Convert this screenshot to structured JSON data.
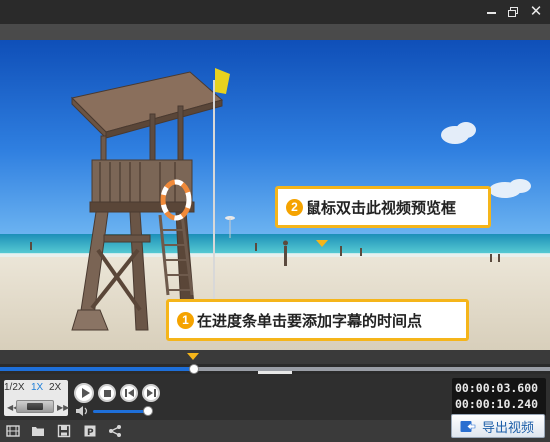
{
  "window": {
    "minimize_icon": "minimize-icon",
    "restore_icon": "restore-icon",
    "close_glyph": "✕"
  },
  "preview": {
    "callout_step2": {
      "number": "2",
      "text": "鼠标双击此视频预览框"
    },
    "callout_step1": {
      "number": "1",
      "text": "在进度条单击要添加字幕的时间点"
    }
  },
  "timeline": {
    "progress_fraction": 0.352,
    "collapse_glyph": "⌄"
  },
  "playback": {
    "speeds": [
      "1/2X",
      "1X",
      "2X"
    ],
    "active_speed": "1X",
    "speed_left_glyph": "◀◀",
    "speed_right_glyph": "▶▶",
    "volume_fraction": 0.9
  },
  "time": {
    "current": "00:00:03.600",
    "total": "00:00:10.240"
  },
  "toolbar": {
    "icons": [
      "video-settings-icon",
      "open-folder-icon",
      "save-icon",
      "save-as-icon",
      "share-icon"
    ],
    "export_label": "导出视频"
  },
  "colors": {
    "accent": "#1e6fd9",
    "callout_border": "#f5b51a",
    "callout_number": "#f5a300"
  }
}
